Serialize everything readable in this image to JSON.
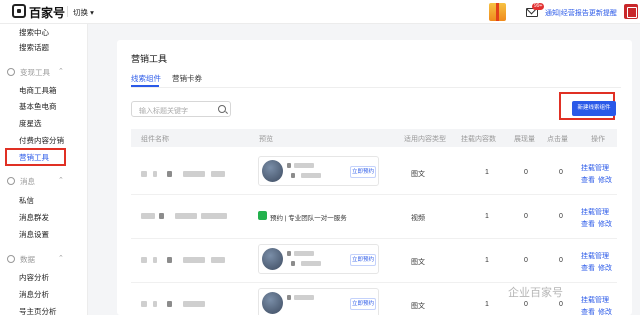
{
  "topbar": {
    "brand": "百家号",
    "switch_label": "切换",
    "gift_badge": "",
    "mail_badge": "99+",
    "notice": "通知|经营报告更新提醒"
  },
  "sidebar": {
    "items_top": [
      "搜索中心",
      "搜索话题"
    ],
    "groups": [
      {
        "label": "变现工具",
        "items": [
          "电商工具箱",
          "基本鱼电商",
          "度星选",
          "付费内容分销",
          "营销工具"
        ]
      },
      {
        "label": "消息",
        "items": [
          "私信",
          "消息群发",
          "消息设置"
        ]
      },
      {
        "label": "数据",
        "items": [
          "内容分析",
          "消息分析",
          "号主页分析"
        ]
      }
    ],
    "active": "营销工具"
  },
  "main": {
    "title": "营销工具",
    "tabs": [
      "线索组件",
      "营销卡券"
    ],
    "search_placeholder": "输入标题关键字",
    "create_button": "新建线索组件",
    "columns": [
      "组件名称",
      "预览",
      "适用内容类型",
      "挂载内容数",
      "展现量",
      "点击量",
      "操作"
    ],
    "rows": [
      {
        "preview_type": "image",
        "publish_label": "立即预约",
        "content_type": "图文",
        "mounted": "1",
        "impressions": "0",
        "clicks": "0",
        "ops": [
          "挂载管理",
          "查看",
          "修改"
        ]
      },
      {
        "preview_type": "text",
        "preview_text": "预约 | 专业团队一对一服务",
        "content_type": "视频",
        "mounted": "1",
        "impressions": "0",
        "clicks": "0",
        "ops": [
          "挂载管理",
          "查看",
          "修改"
        ]
      },
      {
        "preview_type": "image",
        "publish_label": "立即预约",
        "content_type": "图文",
        "mounted": "1",
        "impressions": "0",
        "clicks": "0",
        "ops": [
          "挂载管理",
          "查看",
          "修改"
        ]
      },
      {
        "preview_type": "image",
        "publish_label": "立即预约",
        "content_type": "图文",
        "mounted": "1",
        "impressions": "0",
        "clicks": "0",
        "ops": [
          "挂载管理",
          "查看",
          "修改"
        ]
      }
    ]
  },
  "watermark": "企业百家号",
  "colors": {
    "accent": "#2a59e8",
    "highlight": "#e03024"
  }
}
